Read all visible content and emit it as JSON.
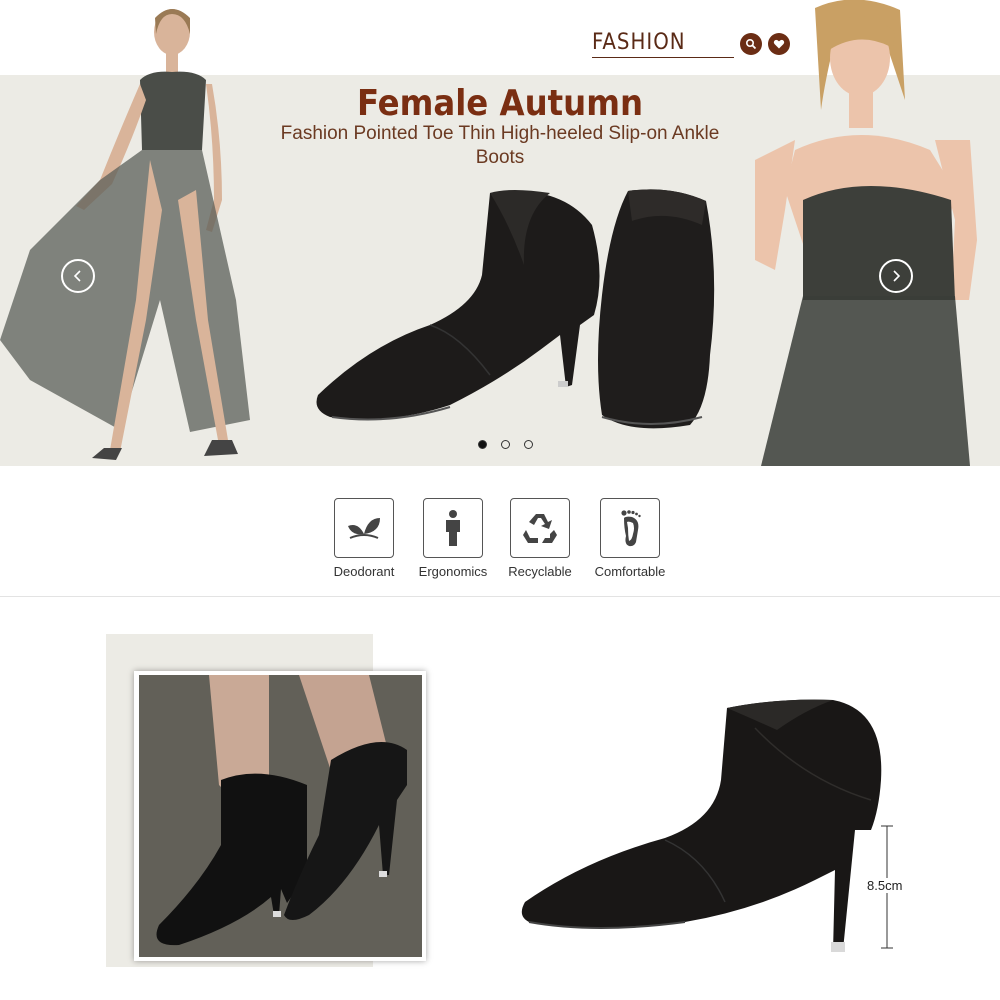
{
  "header": {
    "brand": "FASHION",
    "search_icon": "search-icon",
    "favorite_icon": "heart-icon"
  },
  "hero": {
    "title": "Female Autumn",
    "subtitle": "Fashion Pointed Toe Thin High-heeled Slip-on Ankle Boots",
    "slides_total": 3,
    "active_slide": 1,
    "prev_icon": "chevron-left-icon",
    "next_icon": "chevron-right-icon"
  },
  "features": [
    {
      "label": "Deodorant",
      "icon": "leaf-icon"
    },
    {
      "label": "Ergonomics",
      "icon": "person-icon"
    },
    {
      "label": "Recyclable",
      "icon": "recycle-icon"
    },
    {
      "label": "Comfortable",
      "icon": "footprint-icon"
    }
  ],
  "details": {
    "heel_height": "8.5cm"
  },
  "colors": {
    "brand_brown": "#7a2e12",
    "banner_bg": "#ecebe5",
    "boot_black": "#1a1817"
  }
}
